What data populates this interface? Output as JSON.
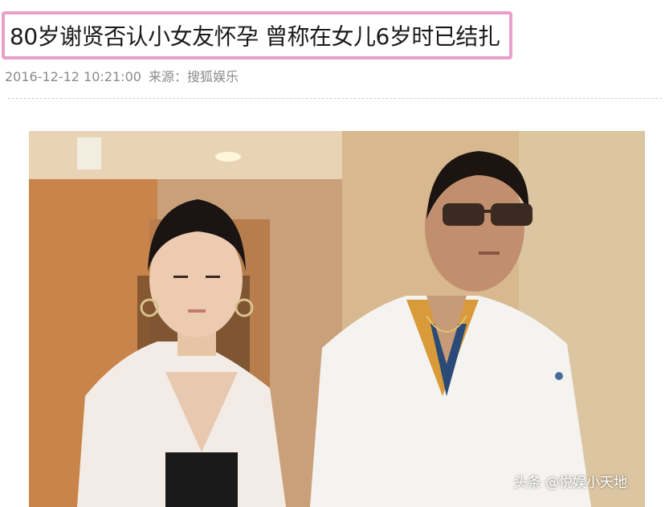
{
  "article": {
    "headline": "80岁谢贤否认小女友怀孕 曾称在女儿6岁时已结扎",
    "timestamp": "2016-12-12 10:21:00",
    "source_label": "来源：",
    "source_name": "搜狐娱乐"
  },
  "photo": {
    "watermark": "头条 @悦娱小天地"
  },
  "colors": {
    "headline_border": "#e9a0c8",
    "meta_text": "#8a8a8a"
  }
}
